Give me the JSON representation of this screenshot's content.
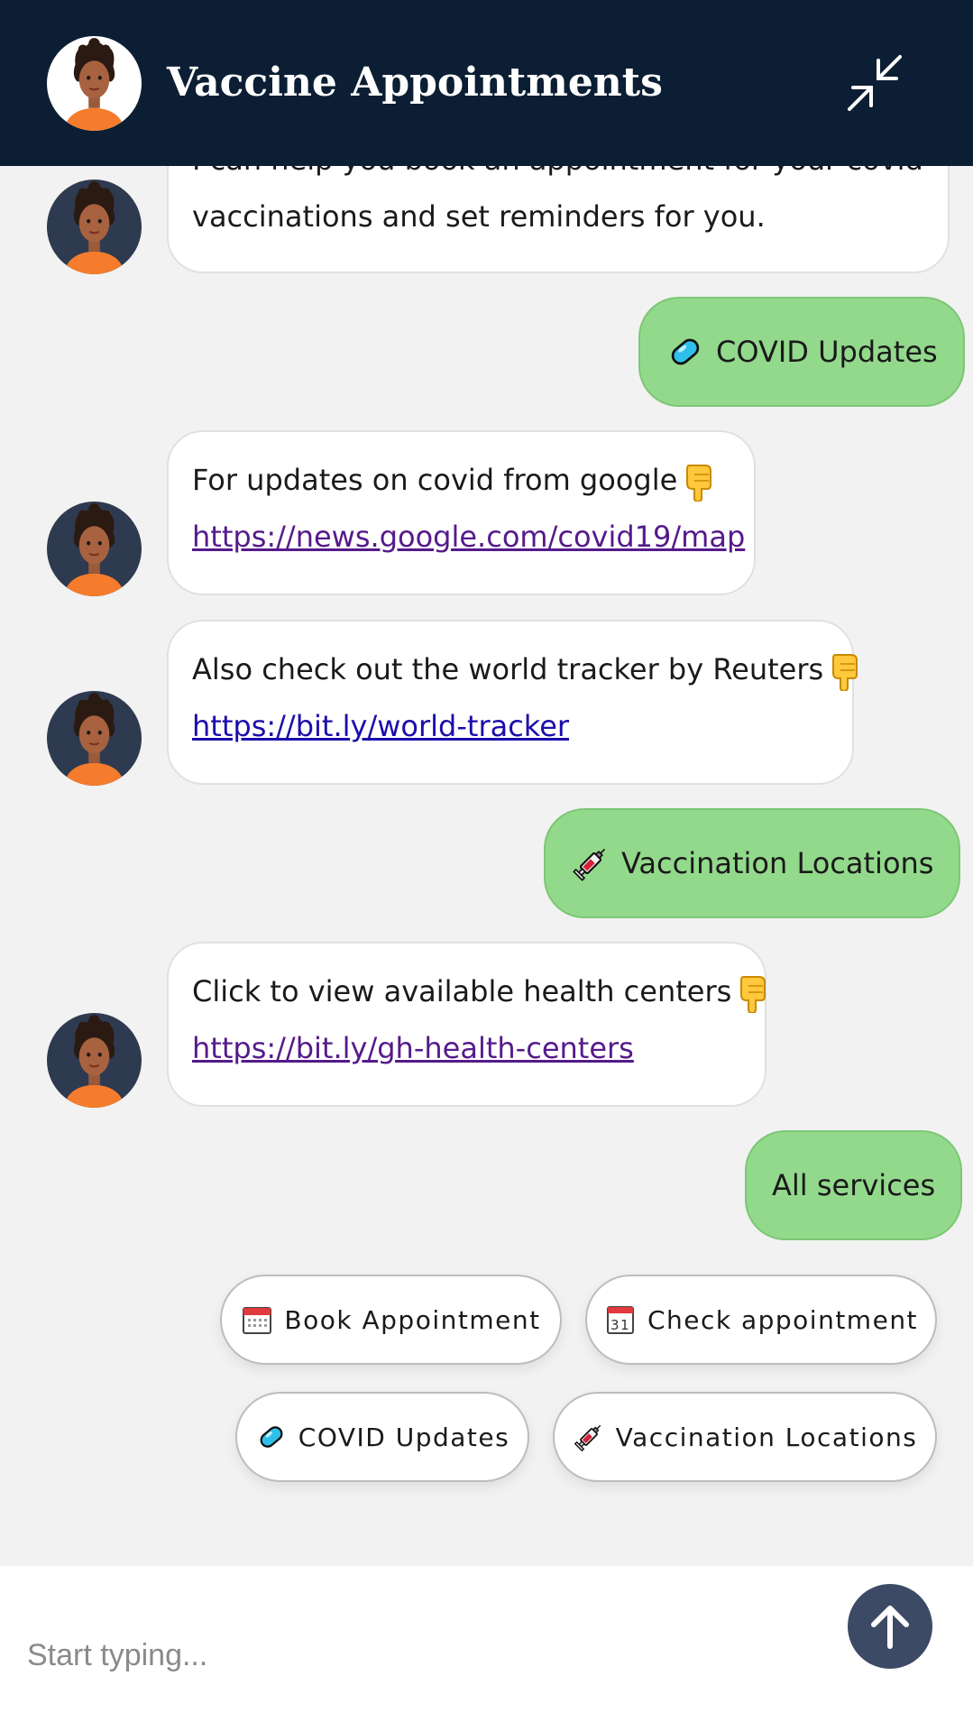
{
  "header": {
    "title": "Vaccine Appointments",
    "bg_color": "#0b1e33",
    "minimize_icon": "collapse-arrows-icon"
  },
  "messages": {
    "intro_partial_line": "I can help you book an appointment for your covid",
    "intro_line2": "vaccinations and set reminders for you.",
    "user_covid": "COVID Updates",
    "google_line": "For updates on covid from google",
    "google_link": "https://news.google.com/covid19/map",
    "reuters_line": "Also check out the world tracker by Reuters",
    "reuters_link": "https://bit.ly/world-tracker",
    "user_locations": "Vaccination Locations",
    "centers_line": "Click to view available health centers",
    "centers_link": "https://bit.ly/gh-health-centers",
    "user_all": "All services"
  },
  "quick_replies": {
    "book": "Book Appointment",
    "check": "Check appointment",
    "covid": "COVID Updates",
    "locations": "Vaccination Locations"
  },
  "composer": {
    "placeholder": "Start typing...",
    "send_icon": "arrow-up-icon"
  },
  "colors": {
    "user_bubble": "#93d98c",
    "bot_bubble": "#ffffff",
    "send_button": "#3d4a66",
    "chat_bg": "#f2f2f2"
  }
}
